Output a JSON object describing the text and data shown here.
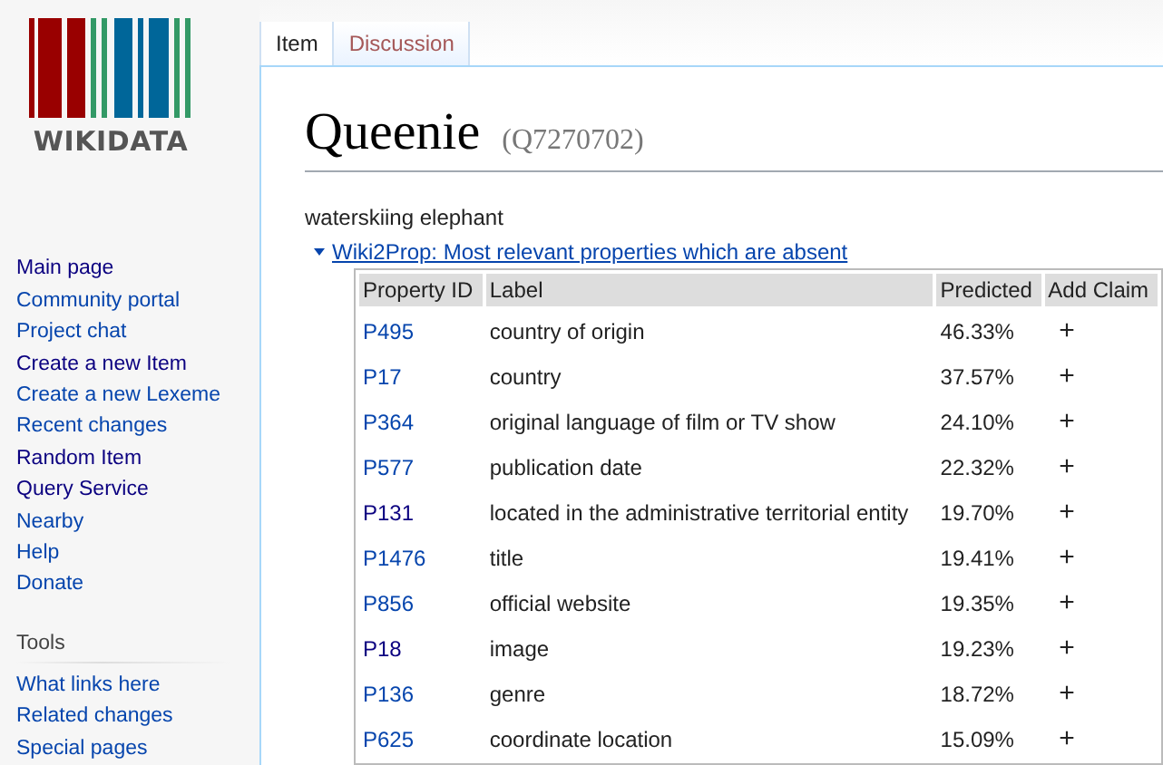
{
  "logo": {
    "wordmark": "WIKIDATA"
  },
  "sidebar": {
    "items": [
      {
        "label": "Main page",
        "visited": true
      },
      {
        "label": "Community portal",
        "visited": false
      },
      {
        "label": "Project chat",
        "visited": false
      },
      {
        "label": "Create a new Item",
        "visited": true
      },
      {
        "label": "Create a new Lexeme",
        "visited": false
      },
      {
        "label": "Recent changes",
        "visited": false
      },
      {
        "label": "Random Item",
        "visited": true
      },
      {
        "label": "Query Service",
        "visited": true
      },
      {
        "label": "Nearby",
        "visited": false
      },
      {
        "label": "Help",
        "visited": false
      },
      {
        "label": "Donate",
        "visited": false
      }
    ],
    "tools": {
      "heading": "Tools",
      "items": [
        {
          "label": "What links here",
          "visited": false
        },
        {
          "label": "Related changes",
          "visited": false
        },
        {
          "label": "Special pages",
          "visited": false
        }
      ]
    }
  },
  "tabs": [
    {
      "label": "Item",
      "selected": true
    },
    {
      "label": "Discussion",
      "selected": false
    }
  ],
  "page": {
    "title": "Queenie",
    "id": "(Q7270702)",
    "description": "waterskiing elephant"
  },
  "wiki2prop": {
    "link": "Wiki2Prop: Most relevant properties which are absent",
    "expanded": true,
    "table": {
      "columns": [
        "Property ID",
        "Label",
        "Predicted",
        "Add Claim"
      ],
      "rows": [
        {
          "id": "P495",
          "visited": false,
          "label": "country of origin",
          "predicted": "46.33%",
          "add": "+"
        },
        {
          "id": "P17",
          "visited": false,
          "label": "country",
          "predicted": "37.57%",
          "add": "+"
        },
        {
          "id": "P364",
          "visited": false,
          "label": "original language of film or TV show",
          "predicted": "24.10%",
          "add": "+"
        },
        {
          "id": "P577",
          "visited": false,
          "label": "publication date",
          "predicted": "22.32%",
          "add": "+"
        },
        {
          "id": "P131",
          "visited": true,
          "label": "located in the administrative territorial entity",
          "predicted": "19.70%",
          "add": "+"
        },
        {
          "id": "P1476",
          "visited": false,
          "label": "title",
          "predicted": "19.41%",
          "add": "+"
        },
        {
          "id": "P856",
          "visited": false,
          "label": "official website",
          "predicted": "19.35%",
          "add": "+"
        },
        {
          "id": "P18",
          "visited": true,
          "label": "image",
          "predicted": "19.23%",
          "add": "+"
        },
        {
          "id": "P136",
          "visited": false,
          "label": "genre",
          "predicted": "18.72%",
          "add": "+"
        },
        {
          "id": "P625",
          "visited": false,
          "label": "coordinate location",
          "predicted": "15.09%",
          "add": "+"
        }
      ]
    }
  }
}
